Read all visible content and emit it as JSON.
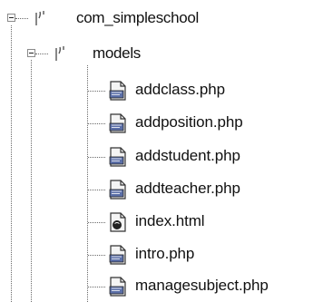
{
  "tree": {
    "root": {
      "label": "com_simpleschool",
      "icon": "folder-icon",
      "expanded": true
    },
    "models": {
      "label": "models",
      "icon": "folder-icon",
      "expanded": true,
      "files": [
        {
          "name": "addclass.php",
          "icon": "php-file-icon"
        },
        {
          "name": "addposition.php",
          "icon": "php-file-icon"
        },
        {
          "name": "addstudent.php",
          "icon": "php-file-icon"
        },
        {
          "name": "addteacher.php",
          "icon": "php-file-icon"
        },
        {
          "name": "index.html",
          "icon": "html-file-icon"
        },
        {
          "name": "intro.php",
          "icon": "php-file-icon"
        },
        {
          "name": "managesubject.php",
          "icon": "php-file-icon"
        }
      ]
    }
  },
  "colors": {
    "tree_line": "#6a6a6a",
    "text": "#111111",
    "php_badge": "#5b6fa8",
    "file_page": "#f4f4f4"
  }
}
